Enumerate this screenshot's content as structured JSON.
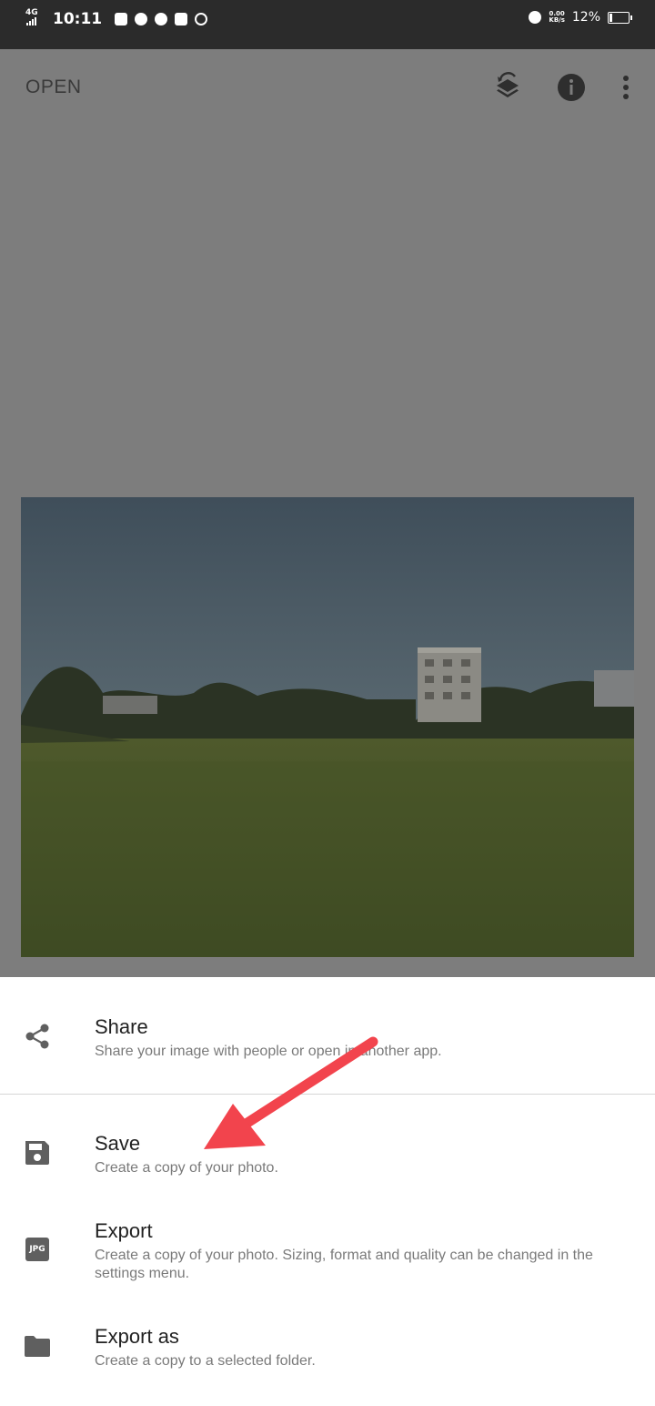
{
  "status_bar": {
    "network": "4G",
    "time": "10:11",
    "speed_value": "0.00",
    "speed_unit": "KB/s",
    "battery": "12%"
  },
  "app_bar": {
    "open_label": "OPEN",
    "icons": [
      "layers-undo-icon",
      "info-icon",
      "more-vert-icon"
    ]
  },
  "sheet": {
    "items": [
      {
        "title": "Share",
        "desc": "Share your image with people or open in another app.",
        "icon": "share-icon"
      },
      {
        "title": "Save",
        "desc": "Create a copy of your photo.",
        "icon": "save-icon"
      },
      {
        "title": "Export",
        "desc": "Create a copy of your photo. Sizing, format and quality can be changed in the settings menu.",
        "icon": "jpg-icon",
        "badge": "JPG"
      },
      {
        "title": "Export as",
        "desc": "Create a copy to a selected folder.",
        "icon": "folder-icon"
      }
    ]
  },
  "colors": {
    "status_bar_bg": "#2b2b2b",
    "scrim": "#7d7d7d",
    "sheet_bg": "#ffffff",
    "annotation_arrow": "#f2444d"
  }
}
